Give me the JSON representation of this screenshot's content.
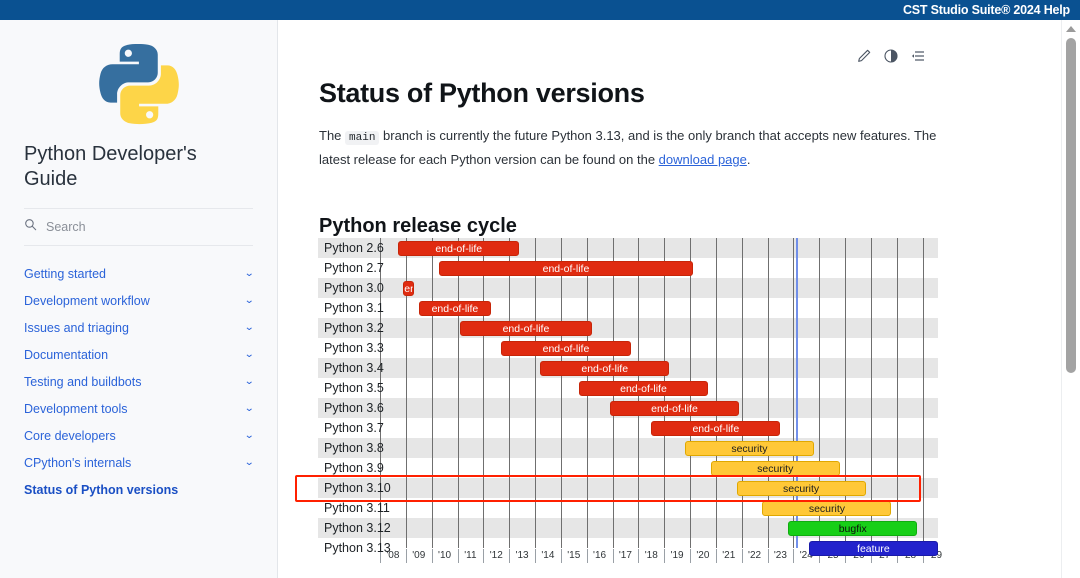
{
  "window": {
    "title": "CST Studio Suite® 2024 Help"
  },
  "sidebar": {
    "brand": "Python Developer's Guide",
    "logo_icon": "python-logo-icon",
    "search": {
      "icon": "search-icon",
      "placeholder": "Search",
      "value": ""
    },
    "items": [
      {
        "label": "Getting started",
        "expandable": true,
        "current": false
      },
      {
        "label": "Development workflow",
        "expandable": true,
        "current": false
      },
      {
        "label": "Issues and triaging",
        "expandable": true,
        "current": false
      },
      {
        "label": "Documentation",
        "expandable": true,
        "current": false
      },
      {
        "label": "Testing and buildbots",
        "expandable": true,
        "current": false
      },
      {
        "label": "Development tools",
        "expandable": true,
        "current": false
      },
      {
        "label": "Core developers",
        "expandable": true,
        "current": false
      },
      {
        "label": "CPython's internals",
        "expandable": true,
        "current": false
      },
      {
        "label": "Status of Python versions",
        "expandable": false,
        "current": true
      }
    ],
    "chevron_glyph": "⌄"
  },
  "content": {
    "tools": [
      {
        "name": "edit-pencil-icon"
      },
      {
        "name": "theme-toggle-icon"
      },
      {
        "name": "toc-list-icon"
      }
    ],
    "page_title": "Status of Python versions",
    "intro": {
      "part1": "The ",
      "code": "main",
      "part2": " branch is currently the future Python 3.13, and is the only branch that accepts new features. The latest release for each Python version can be found on the ",
      "link": "download page",
      "part3": "."
    },
    "section_title": "Python release cycle"
  },
  "scrollbar": {
    "up_arrow": "scroll-up-arrow"
  },
  "chart_data": {
    "type": "bar",
    "subtype": "gantt",
    "title": "Python release cycle",
    "xlabel": "",
    "ylabel": "",
    "xlim": [
      2008,
      2029.6
    ],
    "grid": true,
    "legend": false,
    "today_marker": 2024.1,
    "tick_labels": [
      "'08",
      "'09",
      "'10",
      "'11",
      "'12",
      "'13",
      "'14",
      "'15",
      "'16",
      "'17",
      "'18",
      "'19",
      "'20",
      "'21",
      "'22",
      "'23",
      "'24",
      "'25",
      "'26",
      "'27",
      "'28",
      "'29"
    ],
    "tick_values": [
      2008,
      2009,
      2010,
      2011,
      2012,
      2013,
      2014,
      2015,
      2016,
      2017,
      2018,
      2019,
      2020,
      2021,
      2022,
      2023,
      2024,
      2025,
      2026,
      2027,
      2028,
      2029
    ],
    "status_colors": {
      "end-of-life": "#e02b10",
      "security": "#ffc838",
      "bugfix": "#17cf17",
      "feature": "#2222cc"
    },
    "categories": [
      "Python 2.6",
      "Python 2.7",
      "Python 3.0",
      "Python 3.1",
      "Python 3.2",
      "Python 3.3",
      "Python 3.4",
      "Python 3.5",
      "Python 3.6",
      "Python 3.7",
      "Python 3.8",
      "Python 3.9",
      "Python 3.10",
      "Python 3.11",
      "Python 3.12",
      "Python 3.13"
    ],
    "rows": [
      {
        "version": "Python 2.6",
        "status": "end-of-life",
        "label": "end-of-life",
        "start": 2008.7,
        "end": 2013.4
      },
      {
        "version": "Python 2.7",
        "status": "end-of-life",
        "label": "end-of-life",
        "start": 2010.3,
        "end": 2020.1
      },
      {
        "version": "Python 3.0",
        "status": "end-of-life",
        "label": "end-of-life",
        "start": 2008.9,
        "end": 2009.3
      },
      {
        "version": "Python 3.1",
        "status": "end-of-life",
        "label": "end-of-life",
        "start": 2009.5,
        "end": 2012.3
      },
      {
        "version": "Python 3.2",
        "status": "end-of-life",
        "label": "end-of-life",
        "start": 2011.1,
        "end": 2016.2
      },
      {
        "version": "Python 3.3",
        "status": "end-of-life",
        "label": "end-of-life",
        "start": 2012.7,
        "end": 2017.7
      },
      {
        "version": "Python 3.4",
        "status": "end-of-life",
        "label": "end-of-life",
        "start": 2014.2,
        "end": 2019.2
      },
      {
        "version": "Python 3.5",
        "status": "end-of-life",
        "label": "end-of-life",
        "start": 2015.7,
        "end": 2020.7
      },
      {
        "version": "Python 3.6",
        "status": "end-of-life",
        "label": "end-of-life",
        "start": 2016.9,
        "end": 2021.9
      },
      {
        "version": "Python 3.7",
        "status": "end-of-life",
        "label": "end-of-life",
        "start": 2018.5,
        "end": 2023.5
      },
      {
        "version": "Python 3.8",
        "status": "security",
        "label": "security",
        "start": 2019.8,
        "end": 2024.8
      },
      {
        "version": "Python 3.9",
        "status": "security",
        "label": "security",
        "start": 2020.8,
        "end": 2025.8
      },
      {
        "version": "Python 3.10",
        "status": "security",
        "label": "security",
        "start": 2021.8,
        "end": 2026.8
      },
      {
        "version": "Python 3.11",
        "status": "security",
        "label": "security",
        "start": 2022.8,
        "end": 2027.8
      },
      {
        "version": "Python 3.12",
        "status": "bugfix",
        "label": "bugfix",
        "start": 2023.8,
        "end": 2028.8
      },
      {
        "version": "Python 3.13",
        "status": "feature",
        "label": "feature",
        "start": 2024.6,
        "end": 2029.6
      }
    ],
    "highlight": {
      "row": "Python 3.10",
      "color": "#ff2000"
    }
  }
}
